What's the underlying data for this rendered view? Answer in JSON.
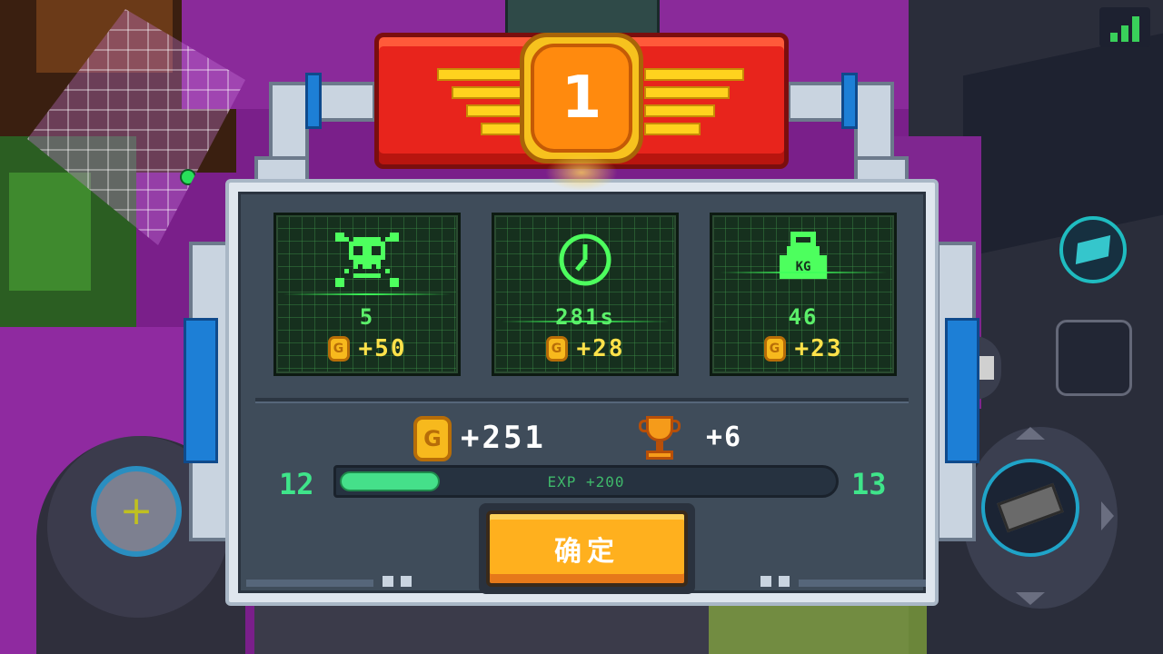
{
  "banner": {
    "rank": "1"
  },
  "stats": [
    {
      "icon": "skull-crossbones-icon",
      "value": "5",
      "reward": "+50"
    },
    {
      "icon": "clock-icon",
      "value": "281s",
      "reward": "+28"
    },
    {
      "icon": "weight-kg-icon",
      "value": "46",
      "reward": "+23",
      "weight_label": "KG"
    }
  ],
  "coin_glyph": "G",
  "totals": {
    "coins": "+251",
    "trophies": "+6"
  },
  "exp": {
    "current_level": "12",
    "next_level": "13",
    "label": "EXP +200",
    "progress": 0.2
  },
  "confirm_button": {
    "label": "确定"
  },
  "colors": {
    "accent_green": "#45e08a",
    "coin_gold": "#f7b91d",
    "button_orange": "#ffb01e",
    "banner_red": "#e8241c"
  }
}
